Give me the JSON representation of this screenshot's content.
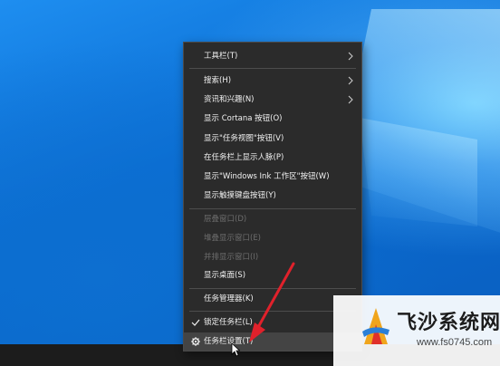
{
  "context_menu": {
    "items": [
      {
        "label": "工具栏(T)",
        "submenu": true,
        "enabled": true
      },
      {
        "label": "搜索(H)",
        "submenu": true,
        "enabled": true
      },
      {
        "label": "资讯和兴趣(N)",
        "submenu": true,
        "enabled": true
      },
      {
        "label": "显示 Cortana 按钮(O)",
        "enabled": true
      },
      {
        "label": "显示\"任务视图\"按钮(V)",
        "enabled": true
      },
      {
        "label": "在任务栏上显示人脉(P)",
        "enabled": true
      },
      {
        "label": "显示\"Windows Ink 工作区\"按钮(W)",
        "enabled": true
      },
      {
        "label": "显示触摸键盘按钮(Y)",
        "enabled": true
      },
      {
        "label": "层叠窗口(D)",
        "enabled": false
      },
      {
        "label": "堆叠显示窗口(E)",
        "enabled": false
      },
      {
        "label": "并排显示窗口(I)",
        "enabled": false
      },
      {
        "label": "显示桌面(S)",
        "enabled": true
      },
      {
        "label": "任务管理器(K)",
        "enabled": true
      },
      {
        "label": "锁定任务栏(L)",
        "enabled": true,
        "checked": true
      },
      {
        "label": "任务栏设置(T)",
        "enabled": true,
        "icon": "gear-icon",
        "highlighted": true
      }
    ]
  },
  "watermark": {
    "title": "飞沙系统网",
    "url": "www.fs0745.com"
  },
  "colors": {
    "menu_bg": "#2b2b2b",
    "menu_hover": "#444444",
    "menu_text": "#f2f2f2",
    "menu_disabled": "#6d6d6d",
    "annotation_arrow": "#e0212b",
    "desktop_blue": "#0a79d8",
    "taskbar": "#1c1c1c"
  }
}
